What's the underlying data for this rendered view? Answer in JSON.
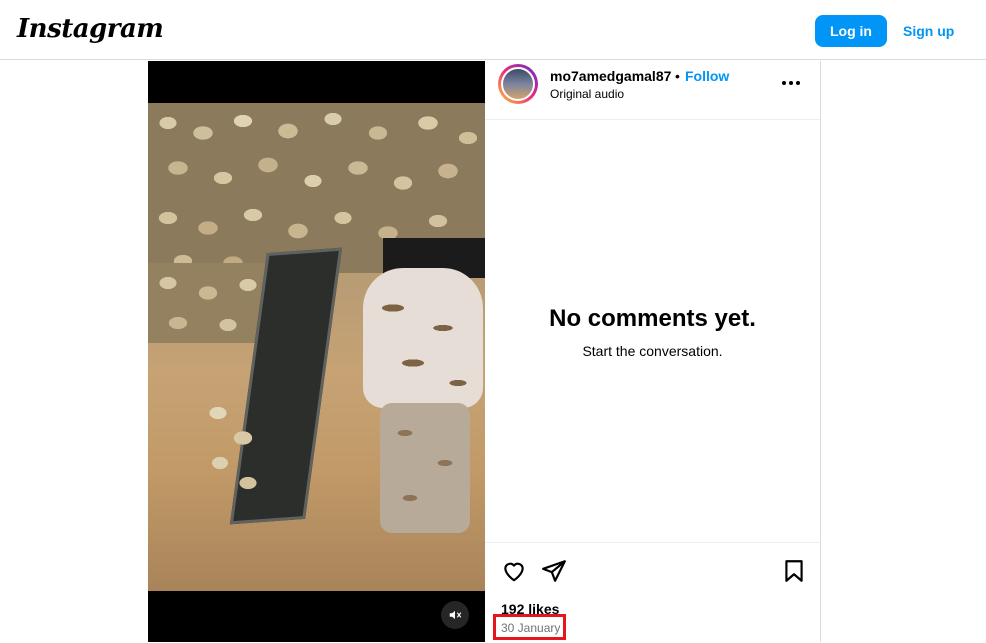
{
  "header": {
    "logo": "Instagram",
    "login_label": "Log in",
    "signup_label": "Sign up",
    "accent_color": "#0095f6"
  },
  "post": {
    "username": "mo7amedgamal87",
    "separator": "•",
    "follow_label": "Follow",
    "audio_label": "Original audio",
    "empty_title": "No comments yet.",
    "empty_subtitle": "Start the conversation.",
    "likes": "192 likes",
    "date": "30 January",
    "highlight_color": "#e4151b"
  },
  "icons": {
    "more": "more-options-icon",
    "like": "heart-icon",
    "share": "paper-plane-icon",
    "save": "bookmark-icon",
    "mute": "muted-speaker-icon"
  }
}
